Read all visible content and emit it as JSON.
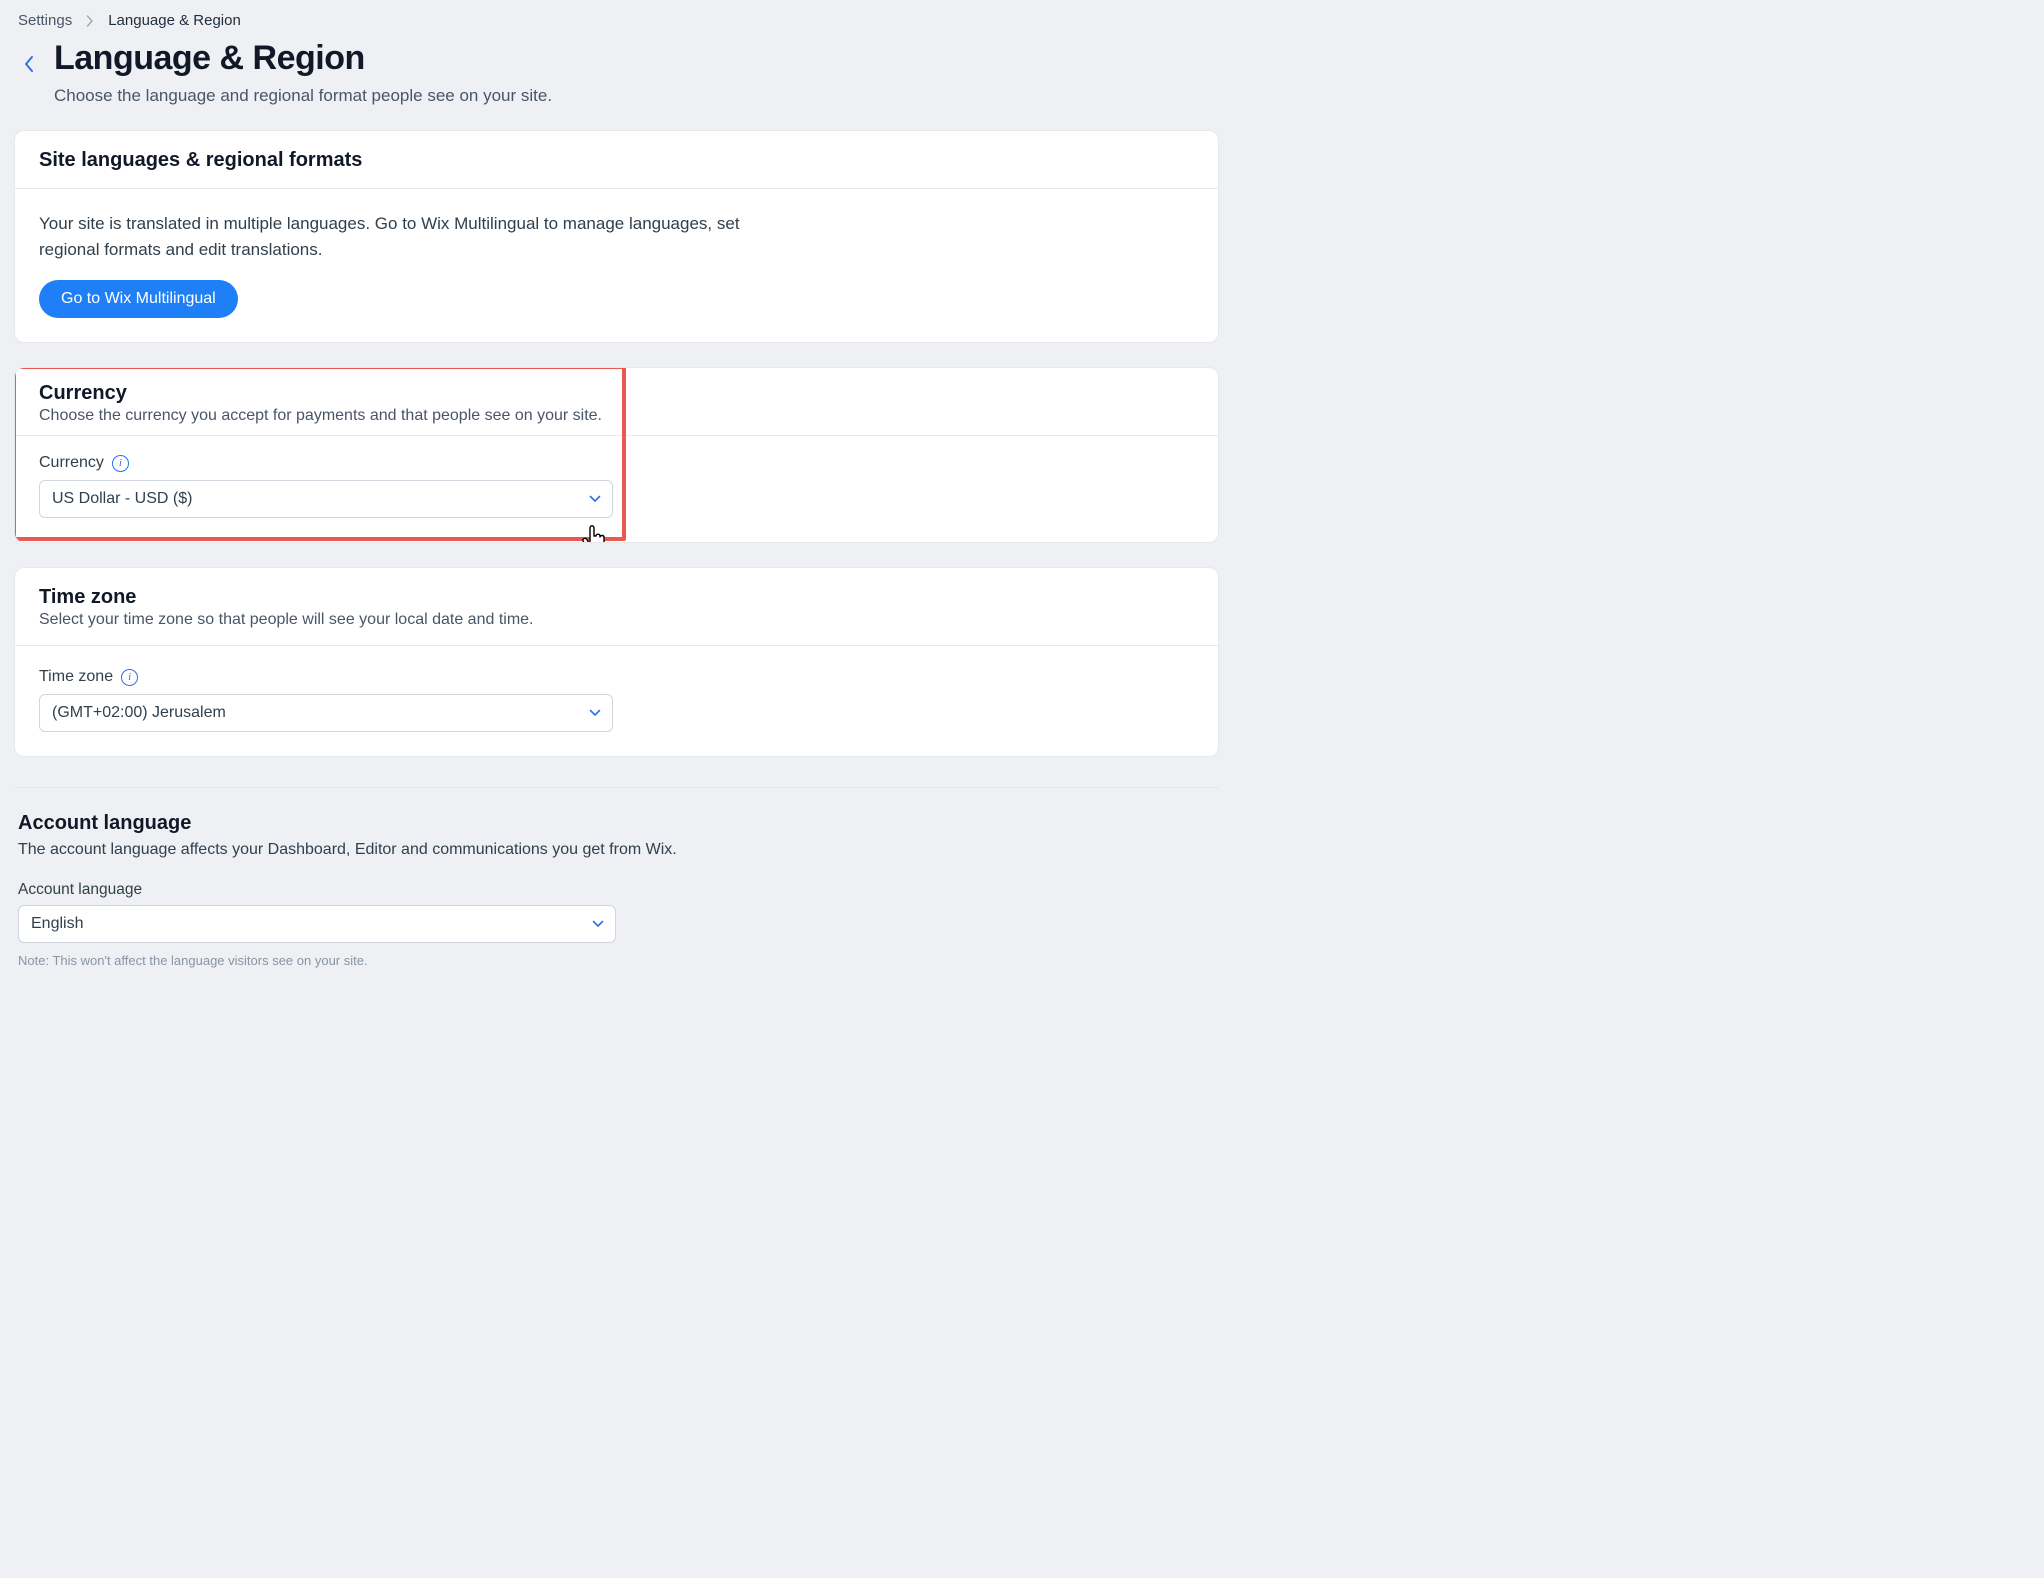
{
  "breadcrumb": {
    "root": "Settings",
    "current": "Language & Region"
  },
  "header": {
    "title": "Language & Region",
    "subtitle": "Choose the language and regional format people see on your site."
  },
  "languages_card": {
    "title": "Site languages & regional formats",
    "body_text": "Your site is translated in multiple languages. Go to Wix Multilingual to manage languages, set regional formats and edit translations.",
    "button_label": "Go to Wix Multilingual"
  },
  "currency_card": {
    "title": "Currency",
    "desc": "Choose the currency you accept for payments and that people see on your site.",
    "field_label": "Currency",
    "value": "US Dollar - USD ($)",
    "highlight_color": "#e85a4f"
  },
  "timezone_card": {
    "title": "Time zone",
    "desc": "Select your time zone so that people will see your local date and time.",
    "field_label": "Time zone",
    "value": "(GMT+02:00) Jerusalem"
  },
  "account_section": {
    "title": "Account language",
    "desc": "The account language affects your Dashboard, Editor and communications you get from Wix.",
    "field_label": "Account language",
    "value": "English",
    "note": "Note: This won't affect the language visitors see on your site."
  },
  "colors": {
    "accent": "#1f7ff6",
    "link": "#2f6fed"
  }
}
